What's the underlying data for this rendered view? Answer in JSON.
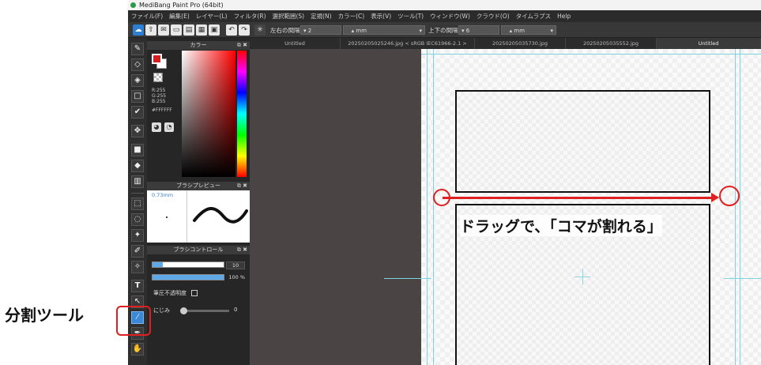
{
  "outer_label": "分割ツール",
  "window": {
    "title": "MediBang Paint Pro (64bit)"
  },
  "menu": [
    "ファイル(F)",
    "編集(E)",
    "レイヤー(L)",
    "フィルタ(R)",
    "選択範囲(S)",
    "定規(N)",
    "カラー(C)",
    "表示(V)",
    "ツール(T)",
    "ウィンドウ(W)",
    "クラウド(O)",
    "タイムラプス",
    "Help"
  ],
  "toolbar": {
    "h_spacing_label": "左右の間隔",
    "h_spacing_value": "2",
    "h_unit": "mm",
    "v_spacing_label": "上下の間隔",
    "v_spacing_value": "6",
    "v_unit": "mm"
  },
  "color_panel": {
    "title": "カラー",
    "r": "R:255",
    "g": "G:255",
    "b": "B:255",
    "hex": "#FFFFFF",
    "fg_color": "#d42020",
    "bg_color": "#ffffff"
  },
  "brush_preview": {
    "title": "ブラシプレビュー",
    "size": "0.73mm"
  },
  "brush_control": {
    "title": "ブラシコントロール",
    "size_value": "10",
    "opacity_value": "100 %",
    "pressure_opacity_label": "筆圧不透明度",
    "blur_label": "にじみ",
    "blur_value": "0"
  },
  "tabs": [
    "Untitled",
    "20250205025246.jpg < sRGB IEC61966-2.1 >",
    "20250205035730.jpg",
    "20250205035552.jpg",
    "Untitled"
  ],
  "annotation": {
    "text": "ドラッグで、「コマが割れる」",
    "accent": "#e02020"
  },
  "icons": [
    "brush-icon",
    "eraser-icon",
    "fill-icon",
    "move-icon",
    "text-icon",
    "divide-tool-icon",
    "hand-icon"
  ]
}
